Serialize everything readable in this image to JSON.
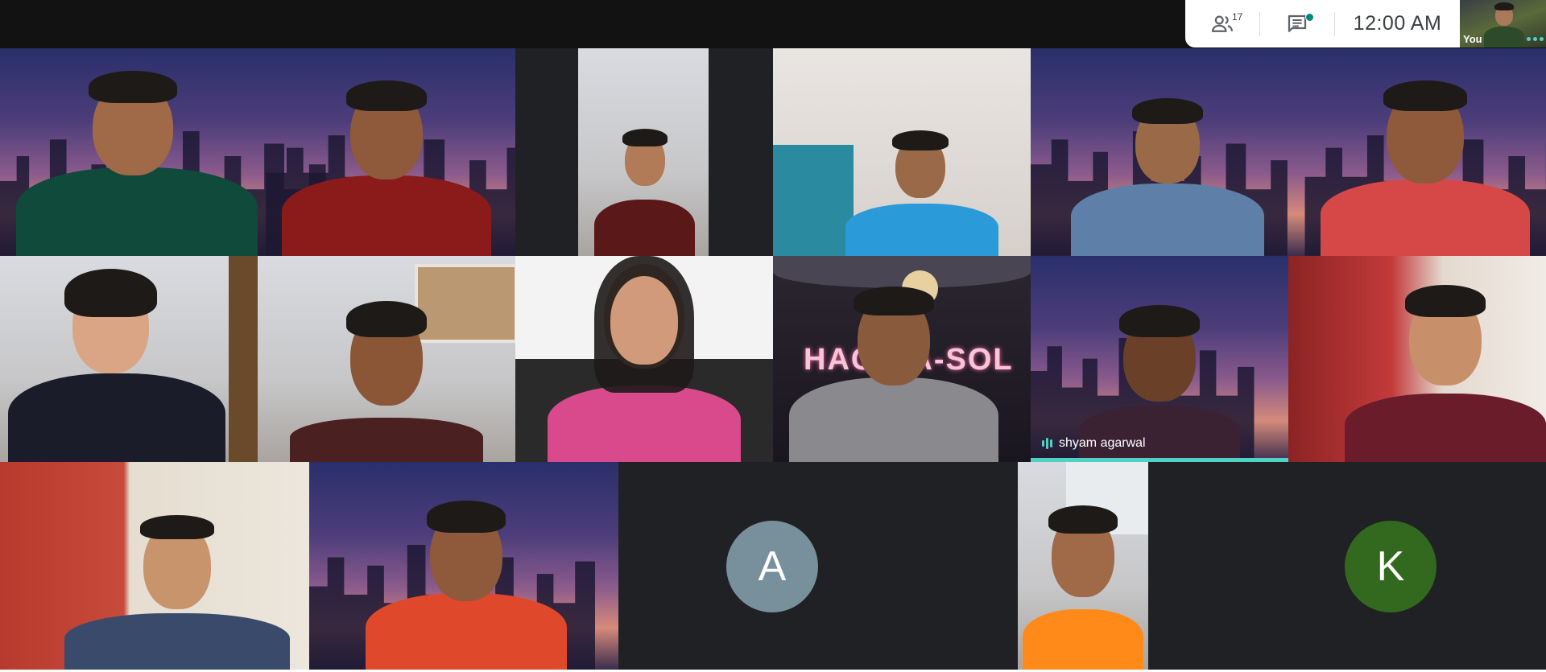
{
  "header": {
    "participants_count": "17",
    "time": "12:00  AM",
    "self_view_label": "You"
  },
  "tiles": {
    "active_speaker_name": "shyam agarwal",
    "avatar_a_initial": "A",
    "avatar_k_initial": "K",
    "background_text": "HACK-A-SOL"
  },
  "colors": {
    "avatar_a": "#78909c",
    "avatar_k": "#33691e",
    "speaking_accent": "#4fd1c5"
  }
}
